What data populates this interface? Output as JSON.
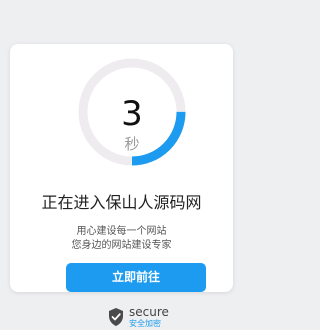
{
  "countdown": {
    "value": "3",
    "unit": "秒",
    "progress_fraction": 0.25,
    "colors": {
      "track": "#efecf0",
      "progress": "#1c9bf0"
    }
  },
  "message": {
    "title": "正在进入保山人源码网",
    "line1": "用心建设每一个网站",
    "line2": "您身边的网站建设专家"
  },
  "action": {
    "button_label": "立即前往"
  },
  "badge": {
    "icon": "shield-check-icon",
    "text": "secure",
    "subtext": "安全加密"
  }
}
